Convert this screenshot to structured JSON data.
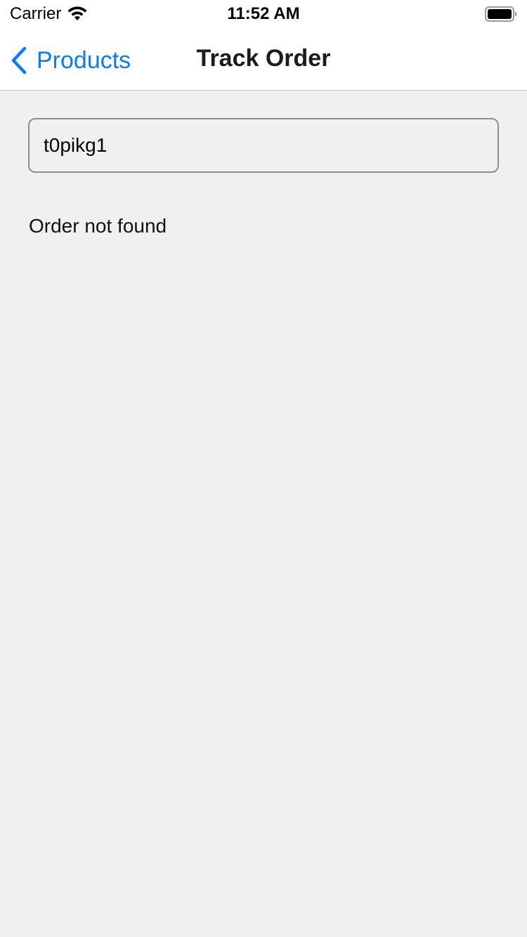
{
  "status_bar": {
    "carrier": "Carrier",
    "time": "11:52 AM"
  },
  "nav": {
    "back_label": "Products",
    "title": "Track Order"
  },
  "tracking": {
    "input_value": "t0pikg1",
    "result_text": "Order not found"
  },
  "colors": {
    "accent": "#0a7aff",
    "background": "#f0f0f0",
    "header": "#ffffff"
  },
  "icons": [
    "wifi-icon",
    "battery-icon",
    "chevron-left-icon"
  ]
}
